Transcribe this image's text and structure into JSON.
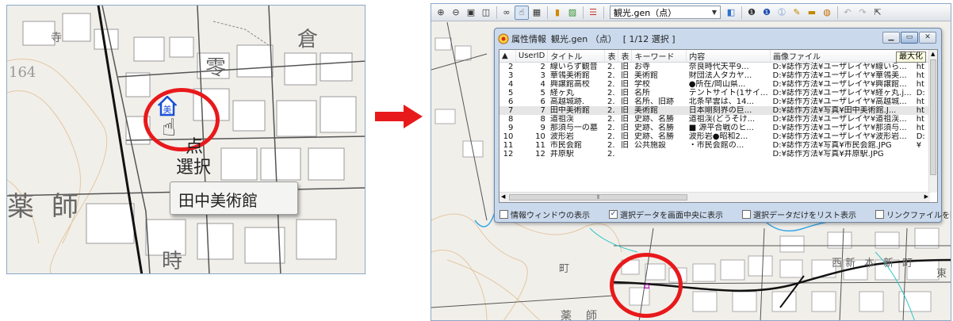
{
  "left_map": {
    "kanji_labels": [
      "薬",
      "師",
      "零",
      "倉",
      "時",
      "寺"
    ],
    "number_label": "164",
    "cursor_label_line1": "点",
    "cursor_label_line2": "選択",
    "tooltip": "田中美術館"
  },
  "right_window": {
    "toolbar": {
      "icons": [
        "zoom-in-icon",
        "zoom-out-icon",
        "zoom-fit-icon",
        "zoom-full-icon",
        "binoculars-icon",
        "hand-pointer-icon",
        "table-icon",
        "bar-chart-icon",
        "image-icon",
        "list-icon",
        "layer-icon",
        "info-icon",
        "info-blue-icon",
        "info-light-icon",
        "pen-icon",
        "ruler-icon",
        "globe-icon",
        "undo-icon",
        "redo-icon",
        "export-icon"
      ],
      "layer_select": "観光.gen（点）"
    },
    "dialog": {
      "title": "属性情報",
      "layer": "観光.gen （点）",
      "selection": "[ 1/12 選択 ]",
      "maximize_tooltip": "最大化",
      "columns": [
        "",
        "UserID",
        "タイトル",
        "表",
        "表",
        "キーワード",
        "内容",
        "画像ファイル",
        ""
      ],
      "rows": [
        [
          "2",
          "2",
          "線いらず観音",
          "2.",
          "旧",
          "お寺",
          "奈良時代天平9...",
          "D:¥誌作方法¥ユーザレイヤ¥線いら...",
          "ht"
        ],
        [
          "3",
          "3",
          "華鴒美術館",
          "2.",
          "旧",
          "美術館",
          "財団法人タカヤ...",
          "D:¥誌作方法¥ユーザレイヤ¥華鴒美...",
          "ht"
        ],
        [
          "4",
          "4",
          "興譲館高校",
          "2.",
          "旧",
          "学校",
          "●所在/岡山県...",
          "D:¥誌作方法¥ユーザレイヤ¥興譲館...",
          "ht"
        ],
        [
          "5",
          "5",
          "経ヶ丸",
          "2.",
          "旧",
          "名所",
          "テントサイト(1サイ...",
          "D:¥誌作方法¥ユーザレイヤ¥経ヶ丸.j...",
          "D:"
        ],
        [
          "6",
          "6",
          "高越城跡.",
          "2.",
          "旧",
          "名所、旧跡",
          "北条早雲は、14...",
          "D:¥誌作方法¥ユーザレイヤ¥高越城...",
          "ht"
        ],
        [
          "7",
          "7",
          "田中美術館",
          "2.",
          "旧",
          "美術館",
          "日本剛刻界の巨...",
          "D:¥誌作方法¥写真¥田中美術館.J...",
          "ht"
        ],
        [
          "8",
          "8",
          "道祖渓",
          "2.",
          "旧",
          "史跡、名勝",
          "道祖渓(どうそけ...",
          "D:¥誌作方法¥ユーザレイヤ¥道祖渓...",
          "ht"
        ],
        [
          "9",
          "9",
          "那須与一の墓",
          "2.",
          "旧",
          "史跡、名勝",
          "■ 源平合戦のヒ...",
          "D:¥誌作方法¥ユーザレイヤ¥那須与...",
          "ht"
        ],
        [
          "10",
          "10",
          "波形岩",
          "2.",
          "旧",
          "史跡、名勝",
          "波形岩●昭和2...",
          "D:¥誌作方法¥ユーザレイヤ¥波形岩...",
          "D:"
        ],
        [
          "11",
          "11",
          "市民会館",
          "2.",
          "旧",
          "公共施設",
          "・市民会館の...",
          "D:¥誌作方法¥写真¥市民会館.JPG",
          "¥"
        ],
        [
          "12",
          "12",
          "井原駅",
          "2.",
          "",
          "",
          "",
          "D:¥誌作方法¥写真¥井原駅.JPG",
          ""
        ]
      ],
      "selected_row_index": 5,
      "checkboxes": [
        {
          "label": "情報ウィンドウの表示",
          "checked": false
        },
        {
          "label": "選択データを画面中央に表示",
          "checked": true
        },
        {
          "label": "選択データだけをリスト表示",
          "checked": false
        },
        {
          "label": "リンクファイルを開く",
          "checked": false
        }
      ]
    },
    "map_labels": [
      "町",
      "薬",
      "師",
      "本",
      "新",
      "町",
      "東",
      "西",
      "新"
    ]
  },
  "colors": {
    "highlight_circle": "#e8191b",
    "arrow": "#e8191b",
    "pin_blue": "#1a4fd6",
    "pin_magenta": "#d400d4"
  }
}
